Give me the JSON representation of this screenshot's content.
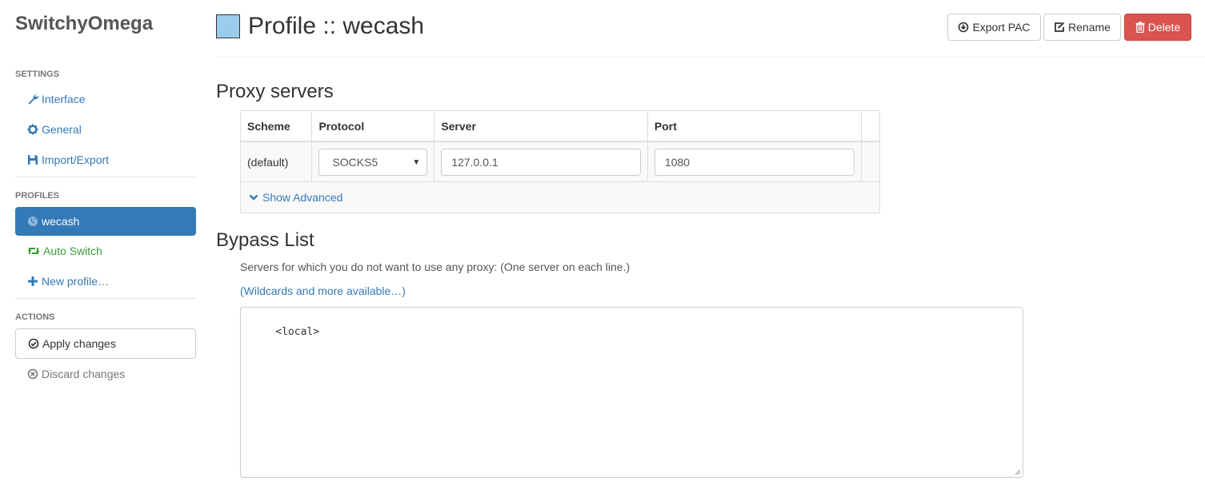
{
  "app": {
    "title": "SwitchyOmega"
  },
  "sidebar": {
    "settings_header": "SETTINGS",
    "settings": [
      {
        "label": "Interface",
        "icon": "wrench-icon"
      },
      {
        "label": "General",
        "icon": "gear-icon"
      },
      {
        "label": "Import/Export",
        "icon": "floppy-icon"
      }
    ],
    "profiles_header": "PROFILES",
    "profiles": [
      {
        "label": "wecash",
        "icon": "globe-icon",
        "active": true
      },
      {
        "label": "Auto Switch",
        "icon": "retweet-icon"
      },
      {
        "label": "New profile…",
        "icon": "plus-icon"
      }
    ],
    "actions_header": "ACTIONS",
    "actions": [
      {
        "label": "Apply changes",
        "icon": "check-circle-icon"
      },
      {
        "label": "Discard changes",
        "icon": "x-circle-icon"
      }
    ]
  },
  "header": {
    "title": "Profile :: wecash",
    "swatch_color": "#99ccee",
    "export_label": "Export PAC",
    "rename_label": "Rename",
    "delete_label": "Delete"
  },
  "proxy": {
    "heading": "Proxy servers",
    "columns": [
      "Scheme",
      "Protocol",
      "Server",
      "Port"
    ],
    "row": {
      "scheme": "(default)",
      "protocol": "SOCKS5",
      "server": "127.0.0.1",
      "port": "1080"
    },
    "advanced_label": "Show Advanced"
  },
  "bypass": {
    "heading": "Bypass List",
    "help": "Servers for which you do not want to use any proxy: (One server on each line.)",
    "link": "(Wildcards and more available…)",
    "value": "<local>"
  },
  "colors": {
    "accent": "#337ab7",
    "danger": "#d9534f",
    "green": "#3c9a3c"
  }
}
